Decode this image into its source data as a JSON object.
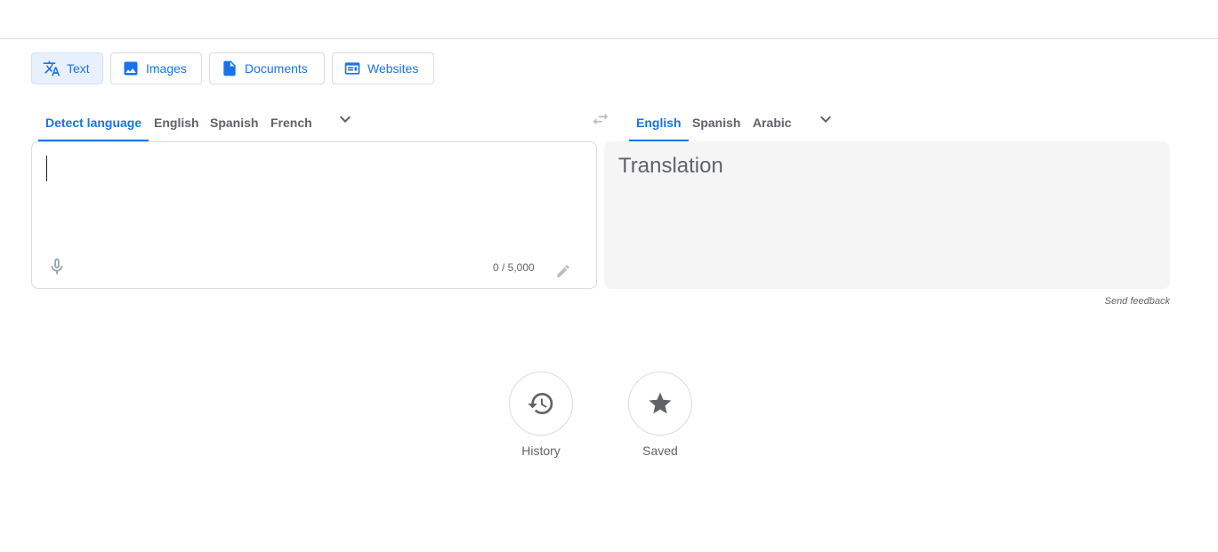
{
  "modes": [
    {
      "label": "Text",
      "icon": "translate-icon",
      "active": true
    },
    {
      "label": "Images",
      "icon": "image-icon",
      "active": false
    },
    {
      "label": "Documents",
      "icon": "document-icon",
      "active": false
    },
    {
      "label": "Websites",
      "icon": "website-icon",
      "active": false
    }
  ],
  "source_languages": [
    {
      "label": "Detect language",
      "active": true
    },
    {
      "label": "English",
      "active": false
    },
    {
      "label": "Spanish",
      "active": false
    },
    {
      "label": "French",
      "active": false
    }
  ],
  "target_languages": [
    {
      "label": "English",
      "active": true
    },
    {
      "label": "Spanish",
      "active": false
    },
    {
      "label": "Arabic",
      "active": false
    }
  ],
  "source": {
    "value": "",
    "char_count": "0 / 5,000"
  },
  "target": {
    "placeholder": "Translation"
  },
  "feedback": {
    "label": "Send feedback"
  },
  "bottom_actions": [
    {
      "label": "History",
      "icon": "history-icon"
    },
    {
      "label": "Saved",
      "icon": "star-icon"
    }
  ],
  "colors": {
    "accent": "#1a73e8",
    "active_mode_bg": "#e8f0fe",
    "muted_text": "#5f6368",
    "target_panel_bg": "#f5f5f5",
    "border": "#dadce0"
  }
}
